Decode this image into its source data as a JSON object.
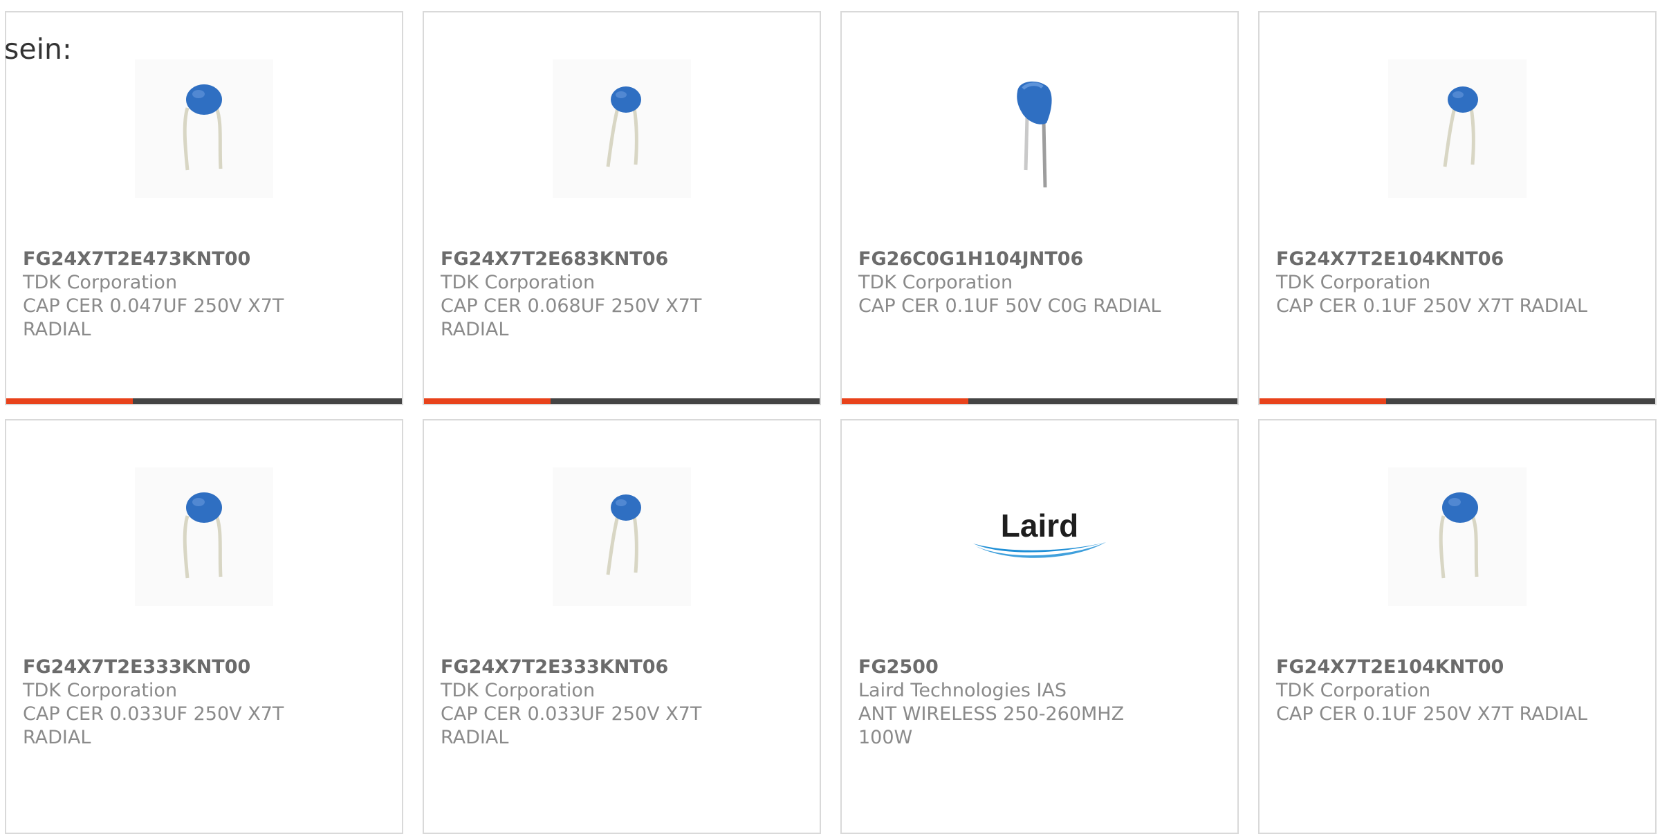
{
  "intro_text": "sein:",
  "colors": {
    "accent": "#e8421b",
    "bar_track": "#444444",
    "card_border": "#d9d9d9",
    "capacitor_blue": "#2f6fc2",
    "laird_blue": "#1f8fd6"
  },
  "products": [
    {
      "part": "FG24X7T2E473KNT00",
      "manufacturer": "TDK Corporation",
      "description": "CAP CER 0.047UF 250V X7T RADIAL",
      "image": "radial-capacitor-small",
      "bar_progress": 0.32
    },
    {
      "part": "FG24X7T2E683KNT06",
      "manufacturer": "TDK Corporation",
      "description": "CAP CER 0.068UF 250V X7T RADIAL",
      "image": "radial-capacitor-small",
      "bar_progress": 0.32
    },
    {
      "part": "FG26C0G1H104JNT06",
      "manufacturer": "TDK Corporation",
      "description": "CAP CER 0.1UF 50V C0G RADIAL",
      "image": "radial-capacitor-large",
      "bar_progress": 0.32
    },
    {
      "part": "FG24X7T2E104KNT06",
      "manufacturer": "TDK Corporation",
      "description": "CAP CER 0.1UF 250V X7T RADIAL",
      "image": "radial-capacitor-small",
      "bar_progress": 0.32
    },
    {
      "part": "FG24X7T2E333KNT00",
      "manufacturer": "TDK Corporation",
      "description": "CAP CER 0.033UF 250V X7T RADIAL",
      "image": "radial-capacitor-small"
    },
    {
      "part": "FG24X7T2E333KNT06",
      "manufacturer": "TDK Corporation",
      "description": "CAP CER 0.033UF 250V X7T RADIAL",
      "image": "radial-capacitor-small"
    },
    {
      "part": "FG2500",
      "manufacturer": "Laird Technologies IAS",
      "description": "ANT WIRELESS 250-260MHZ 100W",
      "image": "laird-logo",
      "logo_text": "Laird"
    },
    {
      "part": "FG24X7T2E104KNT00",
      "manufacturer": "TDK Corporation",
      "description": "CAP CER 0.1UF 250V X7T RADIAL",
      "image": "radial-capacitor-small"
    }
  ]
}
